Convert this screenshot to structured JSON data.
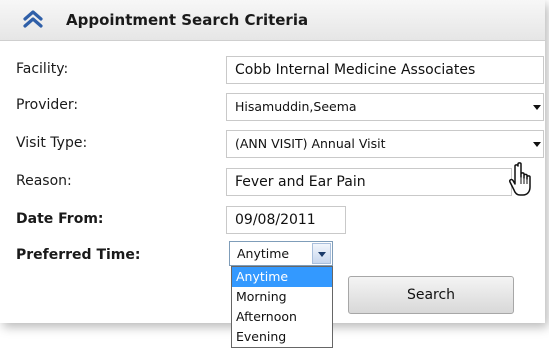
{
  "panel": {
    "title": "Appointment Search Criteria"
  },
  "form": {
    "facility": {
      "label": "Facility:",
      "value": "Cobb Internal Medicine Associates"
    },
    "provider": {
      "label": "Provider:",
      "value": "Hisamuddin,Seema"
    },
    "visit_type": {
      "label": "Visit Type:",
      "value": "(ANN VISIT) Annual Visit"
    },
    "reason": {
      "label": "Reason:",
      "value": "Fever and Ear Pain"
    },
    "date_from": {
      "label": "Date From:",
      "value": "09/08/2011"
    },
    "preferred_time": {
      "label": "Preferred Time:",
      "value": "Anytime",
      "options": [
        "Anytime",
        "Morning",
        "Afternoon",
        "Evening"
      ],
      "highlighted": "Anytime"
    }
  },
  "search_button": {
    "label": "Search"
  },
  "icons": {
    "collapse": "double-chevron-up-icon",
    "cursor": "hand-pointer-icon"
  },
  "colors": {
    "highlight": "#3399ff",
    "chevron": "#2f5fa8"
  }
}
